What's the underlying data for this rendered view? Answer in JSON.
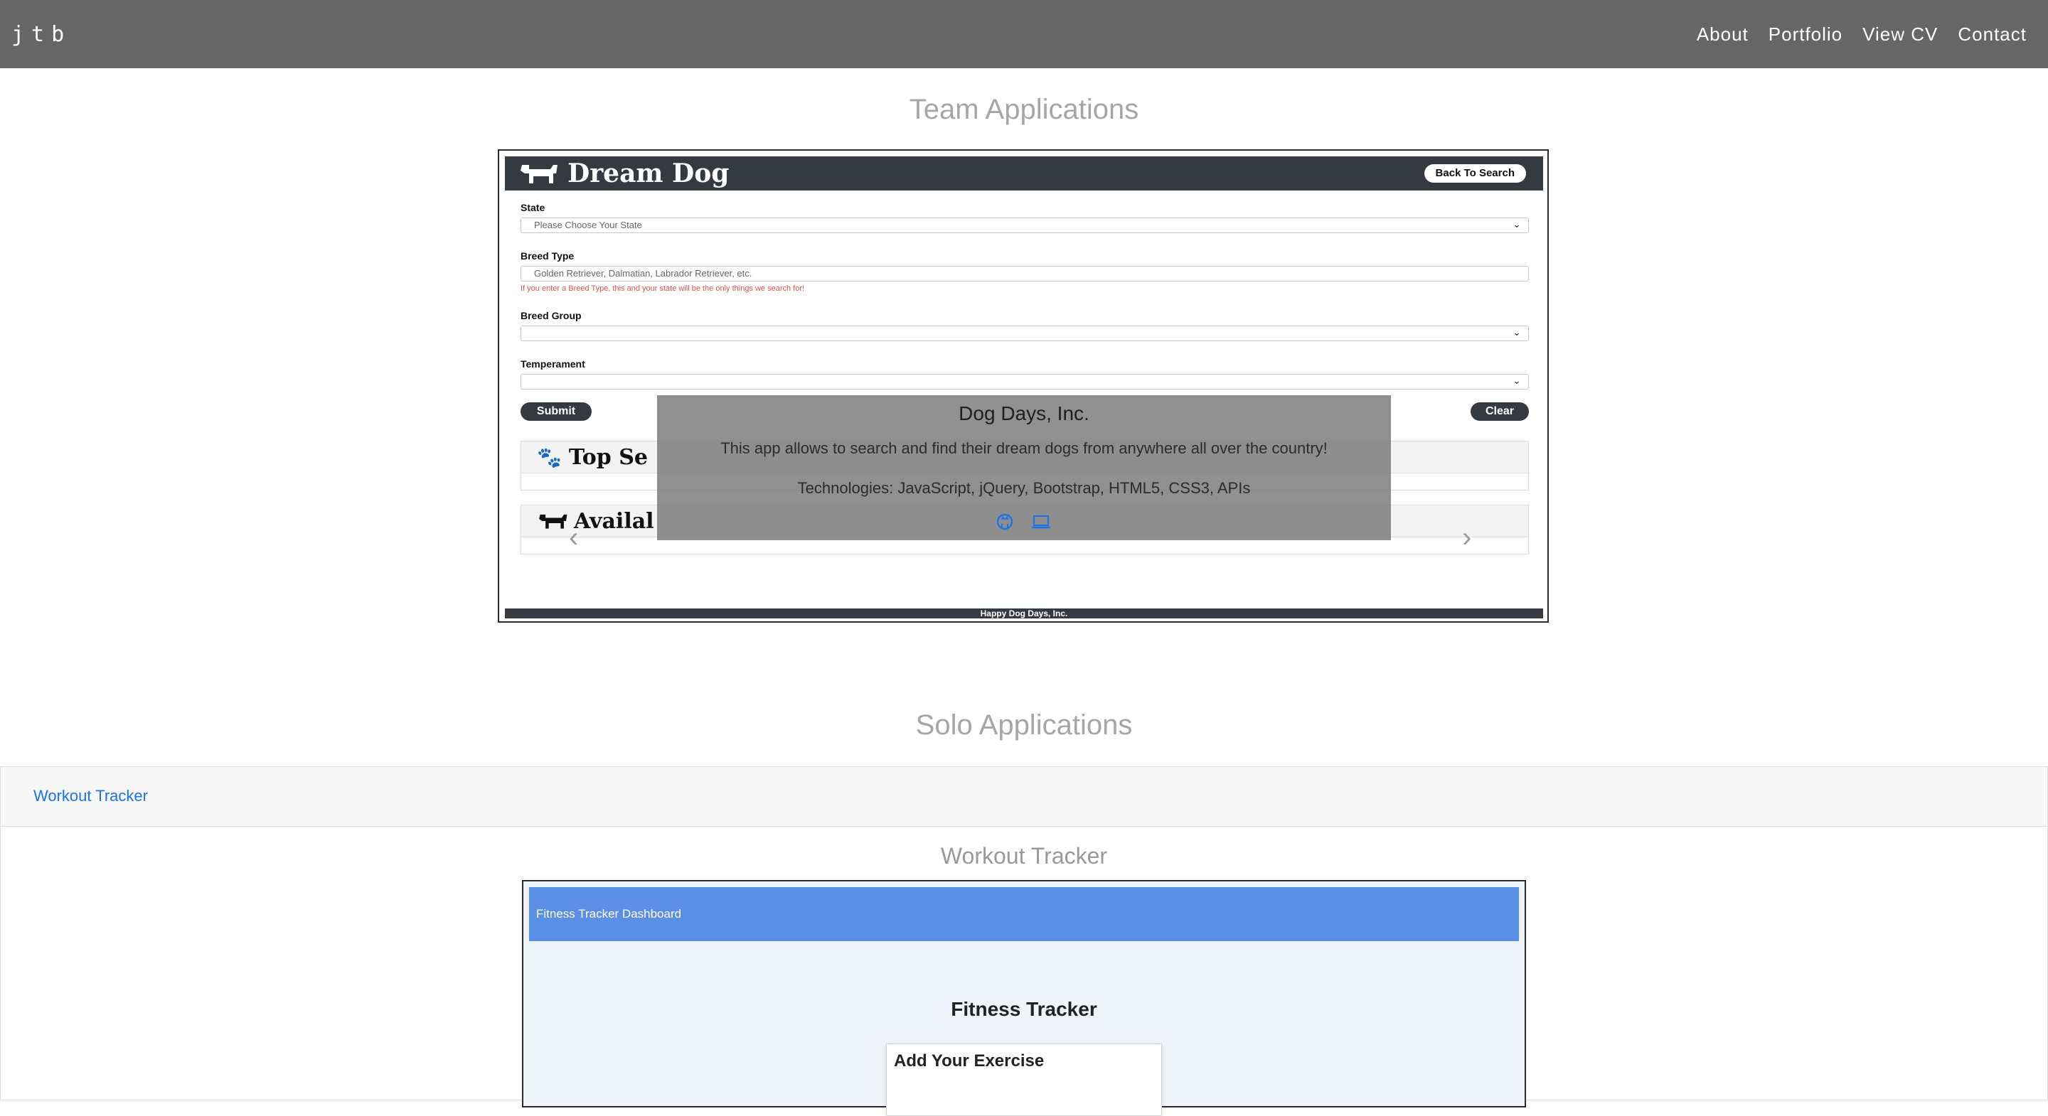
{
  "navbar": {
    "brand": "jtb",
    "links": [
      "About",
      "Portfolio",
      "View CV",
      "Contact"
    ]
  },
  "team": {
    "section_title": "Team Applications",
    "screenshot": {
      "app_title": "Dream Dog",
      "back_button": "Back To Search",
      "state_label": "State",
      "state_placeholder": "Please Choose Your State",
      "breed_type_label": "Breed Type",
      "breed_type_placeholder": "Golden Retriever, Dalmatian, Labrador Retriever, etc.",
      "breed_type_hint": "If you enter a Breed Type, this and your state will be the only things we search for!",
      "breed_group_label": "Breed Group",
      "temperament_label": "Temperament",
      "submit": "Submit",
      "clear": "Clear",
      "top_card_title": "Top Se",
      "available_card_title": "Availal",
      "footer": "Happy Dog Days, Inc."
    },
    "caption": {
      "title": "Dog Days, Inc.",
      "description": "This app allows to search and find their dream dogs from anywhere all over the country!",
      "technologies": "Technologies: JavaScript, jQuery, Bootstrap, HTML5, CSS3, APIs",
      "icons": [
        "github-icon",
        "laptop-icon"
      ]
    }
  },
  "solo": {
    "section_title": "Solo Applications",
    "tab_label": "Workout Tracker",
    "project_title": "Workout Tracker",
    "screenshot": {
      "dashboard_title": "Fitness Tracker Dashboard",
      "page_heading": "Fitness Tracker",
      "card_title": "Add Your Exercise"
    }
  },
  "colors": {
    "navbar": "#666666",
    "section_title": "#a6a6a6",
    "link": "#1a73e8",
    "dream_dog_dark": "#343a40",
    "fitness_blue": "#5b8fe6"
  }
}
